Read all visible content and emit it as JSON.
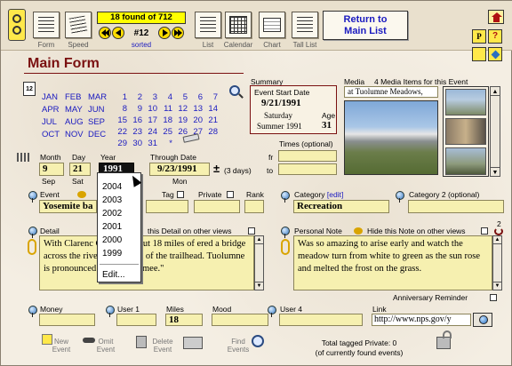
{
  "toolbar": {
    "record_count": "18 found of 712",
    "record_number": "#12",
    "sort_label": "sorted",
    "form_label": "Form",
    "speed_label": "Speed",
    "list_label": "List",
    "calendar_label": "Calendar",
    "chart_label": "Chart",
    "tall_list_label": "Tall List",
    "return_label_1": "Return to",
    "return_label_2": "Main List"
  },
  "title": "Main Form",
  "calendar": {
    "months": [
      "JAN",
      "FEB",
      "MAR",
      "APR",
      "MAY",
      "JUN",
      "JUL",
      "AUG",
      "SEP",
      "OCT",
      "NOV",
      "DEC"
    ],
    "days": [
      "1",
      "2",
      "3",
      "4",
      "5",
      "6",
      "7",
      "8",
      "9",
      "10",
      "11",
      "12",
      "13",
      "14",
      "15",
      "16",
      "17",
      "18",
      "19",
      "20",
      "21",
      "22",
      "23",
      "24",
      "25",
      "26",
      "27",
      "28",
      "29",
      "30",
      "31",
      "*"
    ]
  },
  "summary": {
    "title": "Summary",
    "start_label": "Event Start Date",
    "date": "9/21/1991",
    "weekday": "Saturday",
    "season": "Summer 1991",
    "age_label": "Age",
    "age": "31"
  },
  "media": {
    "label": "Media",
    "count": "4 Media Items for this  Event",
    "caption": "at Tuolumne Meadows,"
  },
  "times": {
    "label": "Times (optional)",
    "fr": "fr",
    "to": "to"
  },
  "date_fields": {
    "month_label": "Month",
    "month": "9",
    "month_sub": "Sep",
    "day_label": "Day",
    "day": "21",
    "day_sub": "Sat",
    "year_label": "Year",
    "year": "1991",
    "through_label": "Through Date",
    "through": "9/23/1991",
    "through_sub": "Mon",
    "days_note": "(3 days)"
  },
  "year_dropdown": {
    "options": [
      "2004",
      "2003",
      "2002",
      "2001",
      "2000",
      "1999"
    ],
    "edit": "Edit..."
  },
  "event": {
    "label": "Event",
    "value": "Yosemite ba",
    "tag_label": "Tag",
    "private_label": "Private",
    "rank_label": "Rank"
  },
  "category": {
    "label": "Category",
    "edit_link": "[edit]",
    "value": "Recreation",
    "cat2_label": "Category 2 (optional)"
  },
  "detail": {
    "label": "Detail",
    "hide_label": "this Detail on other views",
    "text": "With Clarenc               Covered about 18 miles of                       ered a bridge across the river only a                       orth of the trailhead. Tuolumne is pronounced \"too-all-oh-mee.\""
  },
  "note": {
    "label": "Personal Note",
    "hide_label": "Hide this Note on other views",
    "text": "Was so amazing to arise early and watch the meadow turn from white to green as the sun rose and melted the frost on the grass.",
    "count": "2"
  },
  "anniversary_label": "Anniversary Reminder",
  "bottom_fields": {
    "money_label": "Money",
    "user1_label": "User 1",
    "miles_label": "Miles",
    "miles": "18",
    "mood_label": "Mood",
    "user4_label": "User 4",
    "link_label": "Link",
    "link": "http://www.nps.gov/y"
  },
  "footer": {
    "new_event": "New Event",
    "omit_event": "Omit Event",
    "delete_event": "Delete Event",
    "find_events": "Find Events",
    "tagged_line1": "Total tagged Private:   0",
    "tagged_line2": "(of currently found events)"
  },
  "colors": {
    "accent": "#7a1010",
    "field_yellow": "#f6f0b0",
    "calendar_blue": "#1a1ac0",
    "toolbar_yellow": "#ffff00"
  }
}
